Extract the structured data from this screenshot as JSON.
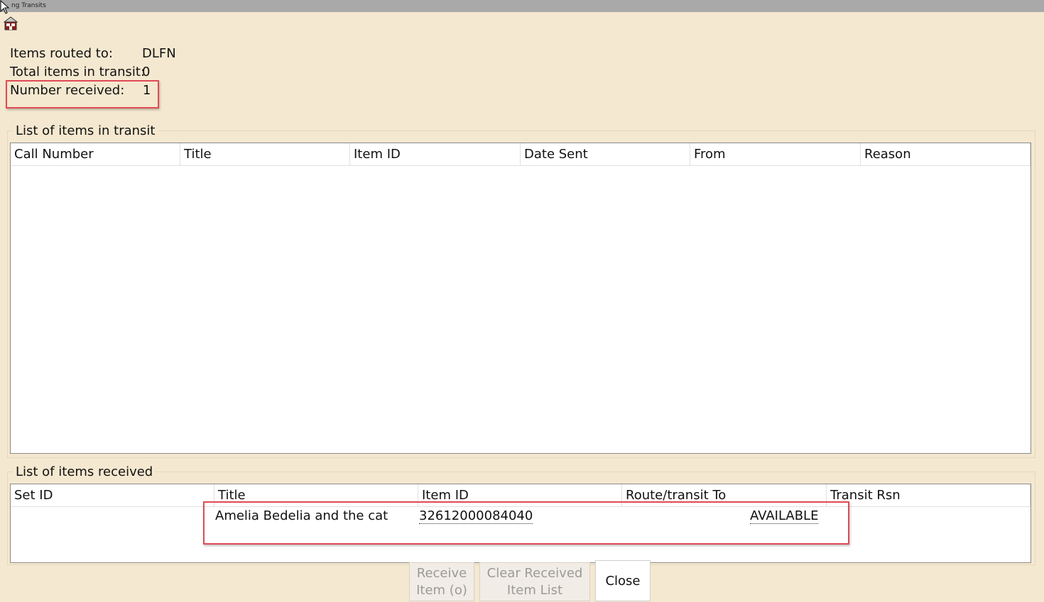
{
  "window": {
    "title": "ng Transits"
  },
  "summary": {
    "routed_label": "Items routed to:",
    "routed_value": "DLFN",
    "total_label": "Total items in transit:",
    "total_value": "0",
    "received_label": "Number received:",
    "received_value": "1"
  },
  "transit_list": {
    "group_label": "List of items in transit",
    "columns": [
      "Call Number",
      "Title",
      "Item ID",
      "Date Sent",
      "From",
      "Reason"
    ]
  },
  "received_list": {
    "group_label": "List of items received",
    "columns": [
      "Set ID",
      "Title",
      "Item ID",
      "Route/transit To",
      "Transit Rsn"
    ],
    "rows": [
      {
        "title": "Amelia Bedelia and the cat",
        "item_id": "32612000084040",
        "route_to": "AVAILABLE"
      }
    ]
  },
  "buttons": {
    "receive_line1": "Receive",
    "receive_line2": "Item (o)",
    "clear_line1": "Clear Received",
    "clear_line2": "Item List",
    "close": "Close"
  },
  "colors": {
    "background": "#f5e8d0",
    "highlight": "#e04a55"
  },
  "icons": [
    "app-icon",
    "mouse-cursor-icon"
  ]
}
